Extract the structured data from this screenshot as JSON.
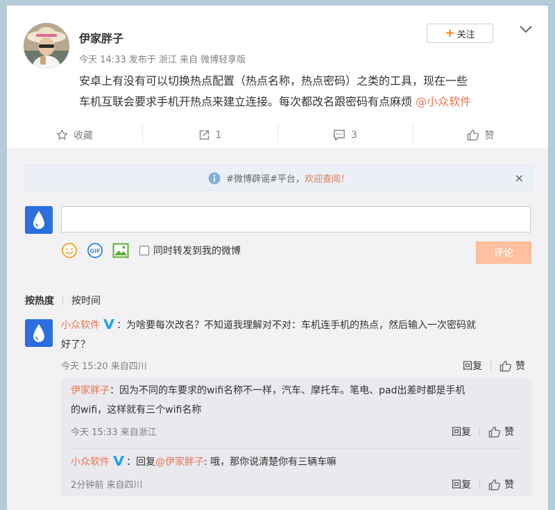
{
  "post": {
    "author": "伊家胖子",
    "meta": "今天 14:33 发布于 浙江  来自 微博轻享版",
    "follow_label": "关注",
    "text_line1": "安卓上有没有可以切换热点配置（热点名称，热点密码）之类的工具，现在一些",
    "text_line2": "车机互联会要求手机开热点来建立连接。每次都改名跟密码有点麻烦 ",
    "mention": "@小众软件"
  },
  "actions": {
    "favorite": "收藏",
    "repost": "1",
    "comment": "3",
    "like": "赞"
  },
  "comment_box": {
    "notice_text": "#微博辟谣#平台，",
    "notice_highlight": "欢迎查阅！",
    "notice_close": "×",
    "input_placeholder": "",
    "repost_label": "同时转发到我的微博",
    "submit_label": "评论"
  },
  "sort": {
    "by_hot": "按热度",
    "by_time": "按时间"
  },
  "comments": [
    {
      "name": "小众软件",
      "text_line1": "：为啥要每次改名？不知道我理解对不对：车机连手机的热点，然后输入一次密码就",
      "text_line2": "好了？",
      "meta": "今天 15:20 来自四川",
      "reply_label": "回复",
      "like_label": "赞",
      "replies": [
        {
          "name": "伊家胖子",
          "text_line1": "：因为不同的车要求的wifi名称不一样，汽车、摩托车。笔电、pad出差时都是手机",
          "text_line2": "的wifi，这样就有三个wifi名称",
          "meta": "今天 15:33 来自浙江",
          "reply_label": "回复",
          "like_label": "赞"
        },
        {
          "name": "小众软件",
          "text_pre": "：回复",
          "mention": "@伊家胖子",
          "text_post": ": 哦，那你说清楚你有三辆车嘛",
          "meta": "2分钟前 来自四川",
          "reply_label": "回复",
          "like_label": "赞"
        }
      ]
    }
  ],
  "colors": {
    "accent": "#eb7350",
    "brand_orange": "#ff8200",
    "verified_blue": "#1ea1f2",
    "submit_disabled": "#ffc09f"
  }
}
